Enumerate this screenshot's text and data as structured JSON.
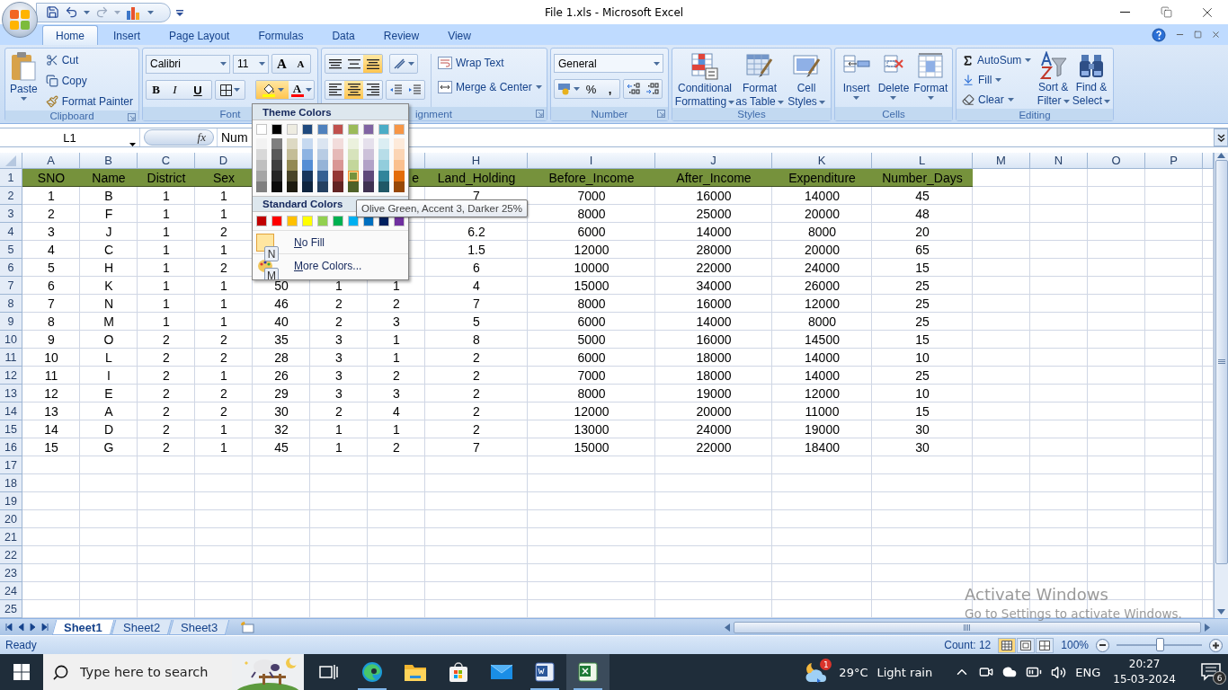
{
  "window": {
    "title": "File 1.xls - Microsoft Excel"
  },
  "ribbon_tabs": [
    {
      "label": "Home",
      "selected": true
    },
    {
      "label": "Insert",
      "selected": false
    },
    {
      "label": "Page Layout",
      "selected": false
    },
    {
      "label": "Formulas",
      "selected": false
    },
    {
      "label": "Data",
      "selected": false
    },
    {
      "label": "Review",
      "selected": false
    },
    {
      "label": "View",
      "selected": false
    }
  ],
  "clipboard": {
    "group_label": "Clipboard",
    "paste": "Paste",
    "cut": "Cut",
    "copy": "Copy",
    "format_painter": "Format Painter"
  },
  "font": {
    "group_label": "Font",
    "font_name": "Calibri",
    "font_size": "11",
    "grow": "A",
    "shrink": "A",
    "bold": "B",
    "italic": "I",
    "underline": "U",
    "font_color": "A",
    "fill_pressed": true
  },
  "alignment": {
    "group_label": "ignment",
    "wrap_text": "Wrap Text",
    "merge_center": "Merge & Center",
    "vertical": [
      {
        "selected": false
      },
      {
        "selected": false
      },
      {
        "selected": true
      }
    ],
    "horizontal": [
      {
        "selected": false
      },
      {
        "selected": true
      },
      {
        "selected": false
      }
    ]
  },
  "number": {
    "group_label": "Number",
    "format": "General",
    "percent": "%",
    "comma": ","
  },
  "styles": {
    "group_label": "Styles",
    "buttons": [
      {
        "kind": "conditional",
        "lines": [
          "Conditional",
          "Formatting"
        ]
      },
      {
        "kind": "table",
        "lines": [
          "Format",
          "as Table"
        ]
      },
      {
        "kind": "cellstyle",
        "lines": [
          "Cell",
          "Styles"
        ]
      }
    ]
  },
  "cells": {
    "group_label": "Cells",
    "buttons": [
      {
        "kind": "insert",
        "label": "Insert"
      },
      {
        "kind": "delete",
        "label": "Delete"
      },
      {
        "kind": "format",
        "label": "Format"
      }
    ]
  },
  "editing": {
    "group_label": "Editing",
    "autosum": "AutoSum",
    "fill": "Fill",
    "clear": "Clear",
    "sort": [
      "Sort &",
      "Filter"
    ],
    "find": [
      "Find &",
      "Select"
    ]
  },
  "formula_bar": {
    "name_box": "L1",
    "function_symbol": "fx",
    "content": "Num"
  },
  "sheet": {
    "columns": [
      "A",
      "B",
      "C",
      "D",
      null,
      null,
      null,
      "H",
      "I",
      "J",
      "K",
      "L",
      "M",
      "N",
      "O",
      "P"
    ],
    "row_numbers": [
      "1",
      "2",
      "3",
      "4",
      "5",
      "6",
      "7",
      "8",
      "9",
      "10",
      "11",
      "12",
      "13",
      "14",
      "15",
      "16",
      "17",
      "18",
      "19",
      "20",
      "21",
      "22",
      "23",
      "24",
      "25"
    ],
    "rows": [
      {
        "kind": "header",
        "cells": [
          "SNO",
          "Name",
          "District",
          "Sex",
          null,
          null,
          "e",
          "Land_Holding",
          "Before_Income",
          "After_Income",
          "Expenditure",
          "Number_Days"
        ]
      },
      {
        "kind": "data",
        "cells": [
          "1",
          "B",
          "1",
          "1",
          null,
          null,
          null,
          "7",
          "7000",
          "16000",
          "14000",
          "45"
        ]
      },
      {
        "kind": "data",
        "cells": [
          "2",
          "F",
          "1",
          "1",
          null,
          null,
          null,
          null,
          "8000",
          "25000",
          "20000",
          "48"
        ]
      },
      {
        "kind": "data",
        "cells": [
          "3",
          "J",
          "1",
          "2",
          null,
          null,
          null,
          "6.2",
          "6000",
          "14000",
          "8000",
          "20"
        ]
      },
      {
        "kind": "data",
        "cells": [
          "4",
          "C",
          "1",
          "1",
          null,
          null,
          null,
          "1.5",
          "12000",
          "28000",
          "20000",
          "65"
        ]
      },
      {
        "kind": "data",
        "cells": [
          "5",
          "H",
          "1",
          "2",
          null,
          null,
          null,
          "6",
          "10000",
          "22000",
          "24000",
          "15"
        ]
      },
      {
        "kind": "data",
        "cells": [
          "6",
          "K",
          "1",
          "1",
          "50",
          "1",
          "1",
          "4",
          "15000",
          "34000",
          "26000",
          "25"
        ]
      },
      {
        "kind": "data",
        "cells": [
          "7",
          "N",
          "1",
          "1",
          "46",
          "2",
          "2",
          "7",
          "8000",
          "16000",
          "12000",
          "25"
        ]
      },
      {
        "kind": "data",
        "cells": [
          "8",
          "M",
          "1",
          "1",
          "40",
          "2",
          "3",
          "5",
          "6000",
          "14000",
          "8000",
          "25"
        ]
      },
      {
        "kind": "data",
        "cells": [
          "9",
          "O",
          "2",
          "2",
          "35",
          "3",
          "1",
          "8",
          "5000",
          "16000",
          "14500",
          "15"
        ]
      },
      {
        "kind": "data",
        "cells": [
          "10",
          "L",
          "2",
          "2",
          "28",
          "3",
          "1",
          "2",
          "6000",
          "18000",
          "14000",
          "10"
        ]
      },
      {
        "kind": "data",
        "cells": [
          "11",
          "I",
          "2",
          "1",
          "26",
          "3",
          "2",
          "2",
          "7000",
          "18000",
          "14000",
          "25"
        ]
      },
      {
        "kind": "data",
        "cells": [
          "12",
          "E",
          "2",
          "2",
          "29",
          "3",
          "3",
          "2",
          "8000",
          "19000",
          "12000",
          "10"
        ]
      },
      {
        "kind": "data",
        "cells": [
          "13",
          "A",
          "2",
          "2",
          "30",
          "2",
          "4",
          "2",
          "12000",
          "20000",
          "11000",
          "15"
        ]
      },
      {
        "kind": "data",
        "cells": [
          "14",
          "D",
          "2",
          "1",
          "32",
          "1",
          "1",
          "2",
          "13000",
          "24000",
          "19000",
          "30"
        ]
      },
      {
        "kind": "data",
        "cells": [
          "15",
          "G",
          "2",
          "1",
          "45",
          "1",
          "2",
          "7",
          "15000",
          "22000",
          "18400",
          "30"
        ]
      }
    ]
  },
  "color_menu": {
    "title": "Theme Colors",
    "theme_colors": [
      {
        "color": "#ffffff",
        "selected": false,
        "shades": [
          {
            "color": "#f2f2f2",
            "selected": false
          },
          {
            "color": "#d8d8d8",
            "selected": false
          },
          {
            "color": "#bfbfbf",
            "selected": false
          },
          {
            "color": "#a5a5a5",
            "selected": false
          },
          {
            "color": "#7f7f7f",
            "selected": false
          }
        ]
      },
      {
        "color": "#000000",
        "selected": false,
        "shades": [
          {
            "color": "#7f7f7f",
            "selected": false
          },
          {
            "color": "#595959",
            "selected": false
          },
          {
            "color": "#3f3f3f",
            "selected": false
          },
          {
            "color": "#262626",
            "selected": false
          },
          {
            "color": "#0c0c0c",
            "selected": false
          }
        ]
      },
      {
        "color": "#eeece1",
        "selected": false,
        "shades": [
          {
            "color": "#ddd9c3",
            "selected": false
          },
          {
            "color": "#c4bd97",
            "selected": false
          },
          {
            "color": "#938953",
            "selected": false
          },
          {
            "color": "#494429",
            "selected": false
          },
          {
            "color": "#1d1b10",
            "selected": false
          }
        ]
      },
      {
        "color": "#1f497d",
        "selected": false,
        "shades": [
          {
            "color": "#c6d9f0",
            "selected": false
          },
          {
            "color": "#8db3e2",
            "selected": false
          },
          {
            "color": "#548dd4",
            "selected": false
          },
          {
            "color": "#17365d",
            "selected": false
          },
          {
            "color": "#0f243e",
            "selected": false
          }
        ]
      },
      {
        "color": "#4f81bd",
        "selected": false,
        "shades": [
          {
            "color": "#dbe5f1",
            "selected": false
          },
          {
            "color": "#b8cce4",
            "selected": false
          },
          {
            "color": "#95b3d7",
            "selected": false
          },
          {
            "color": "#366092",
            "selected": false
          },
          {
            "color": "#244061",
            "selected": false
          }
        ]
      },
      {
        "color": "#c0504d",
        "selected": false,
        "shades": [
          {
            "color": "#f2dcdb",
            "selected": false
          },
          {
            "color": "#e5b9b7",
            "selected": false
          },
          {
            "color": "#d99694",
            "selected": false
          },
          {
            "color": "#953734",
            "selected": false
          },
          {
            "color": "#632423",
            "selected": false
          }
        ]
      },
      {
        "color": "#9bbb59",
        "selected": false,
        "shades": [
          {
            "color": "#ebf1dd",
            "selected": false
          },
          {
            "color": "#d7e3bc",
            "selected": false
          },
          {
            "color": "#c3d69b",
            "selected": false
          },
          {
            "color": "#76923c",
            "selected": true
          },
          {
            "color": "#4f6128",
            "selected": false
          }
        ]
      },
      {
        "color": "#8064a2",
        "selected": false,
        "shades": [
          {
            "color": "#e5e0ec",
            "selected": false
          },
          {
            "color": "#ccc1d9",
            "selected": false
          },
          {
            "color": "#b2a2c7",
            "selected": false
          },
          {
            "color": "#5f497a",
            "selected": false
          },
          {
            "color": "#3f3151",
            "selected": false
          }
        ]
      },
      {
        "color": "#4bacc6",
        "selected": false,
        "shades": [
          {
            "color": "#dbeef3",
            "selected": false
          },
          {
            "color": "#b7dde8",
            "selected": false
          },
          {
            "color": "#92cddc",
            "selected": false
          },
          {
            "color": "#31859b",
            "selected": false
          },
          {
            "color": "#205867",
            "selected": false
          }
        ]
      },
      {
        "color": "#f79646",
        "selected": false,
        "shades": [
          {
            "color": "#fdeada",
            "selected": false
          },
          {
            "color": "#fbd5b5",
            "selected": false
          },
          {
            "color": "#fac08f",
            "selected": false
          },
          {
            "color": "#e36c09",
            "selected": false
          },
          {
            "color": "#974806",
            "selected": false
          }
        ]
      }
    ],
    "standard_title": "Standard Colors",
    "standard_colors": [
      {
        "color": "#c00000",
        "selected": false
      },
      {
        "color": "#ff0000",
        "selected": false
      },
      {
        "color": "#ffc000",
        "selected": false
      },
      {
        "color": "#ffff00",
        "selected": false
      },
      {
        "color": "#92d050",
        "selected": false
      },
      {
        "color": "#00b050",
        "selected": false
      },
      {
        "color": "#00b0f0",
        "selected": false
      },
      {
        "color": "#0070c0",
        "selected": false
      },
      {
        "color": "#002060",
        "selected": false
      },
      {
        "color": "#7030a0",
        "selected": false
      }
    ],
    "no_fill": "No Fill",
    "no_fill_key": "N",
    "more_colors": "More Colors...",
    "more_colors_key": "M",
    "tooltip": "Olive Green, Accent 3, Darker 25%"
  },
  "sheet_tabs": [
    {
      "label": "Sheet1",
      "selected": true
    },
    {
      "label": "Sheet2",
      "selected": false
    },
    {
      "label": "Sheet3",
      "selected": false
    }
  ],
  "status_bar": {
    "status": "Ready",
    "count": "Count: 12",
    "views": [
      {
        "selected": true
      },
      {
        "selected": false
      },
      {
        "selected": false
      }
    ],
    "zoom": "100%",
    "zoom_slider": {
      "level": 0.5
    }
  },
  "activation": {
    "title": "Activate Windows",
    "hint": "Go to Settings to activate Windows."
  },
  "taskbar": {
    "search_placeholder": "Type here to search",
    "apps": [
      {
        "kind": "taskview",
        "selected": false,
        "running": false
      },
      {
        "kind": "edge",
        "selected": false,
        "running": true
      },
      {
        "kind": "explorer",
        "selected": false,
        "running": false
      },
      {
        "kind": "store",
        "selected": false,
        "running": false
      },
      {
        "kind": "mail",
        "selected": false,
        "running": false
      },
      {
        "kind": "word",
        "selected": false,
        "running": true
      },
      {
        "kind": "excel",
        "selected": true,
        "running": true
      }
    ],
    "weather": {
      "badge": "1",
      "temperature": "29°C",
      "condition": "Light rain"
    },
    "language": "ENG",
    "time": "20:27",
    "date": "15-03-2024",
    "notifications": "6"
  }
}
